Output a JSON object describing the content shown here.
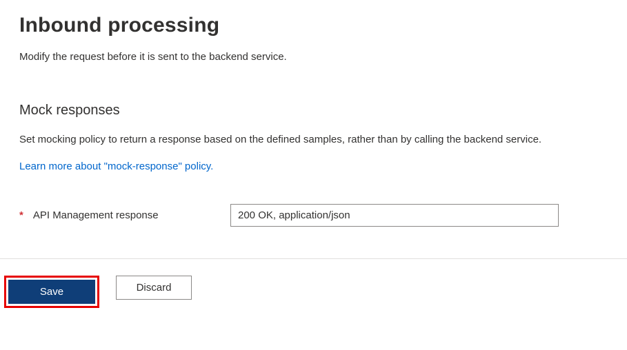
{
  "header": {
    "title": "Inbound processing",
    "subtitle": "Modify the request before it is sent to the backend service."
  },
  "section": {
    "title": "Mock responses",
    "description": "Set mocking policy to return a response based on the defined samples, rather than by calling the backend service.",
    "learn_more_text": "Learn more about \"mock-response\" policy."
  },
  "form": {
    "required_mark": "*",
    "field_label": "API Management response",
    "field_value": "200 OK, application/json"
  },
  "buttons": {
    "save": "Save",
    "discard": "Discard"
  }
}
